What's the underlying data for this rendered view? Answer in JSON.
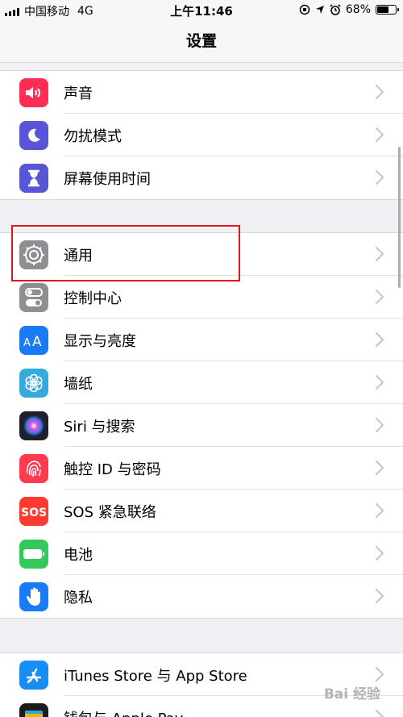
{
  "status_bar": {
    "carrier": "中国移动",
    "network": "4G",
    "time": "上午11:46",
    "battery_text": "68%",
    "battery_level": 0.68
  },
  "nav": {
    "title": "设置"
  },
  "groups": [
    {
      "items": [
        {
          "label": "声音",
          "icon": "speaker-icon",
          "color": "#fe2d55"
        },
        {
          "label": "勿扰模式",
          "icon": "moon-icon",
          "color": "#5856d6"
        },
        {
          "label": "屏幕使用时间",
          "icon": "hourglass-icon",
          "color": "#5856d6"
        }
      ]
    },
    {
      "items": [
        {
          "label": "通用",
          "icon": "gear-icon",
          "color": "#8e8e93"
        },
        {
          "label": "控制中心",
          "icon": "toggles-icon",
          "color": "#8e8e93"
        },
        {
          "label": "显示与亮度",
          "icon": "text-size-icon",
          "color": "#1a7cf5"
        },
        {
          "label": "墙纸",
          "icon": "flower-icon",
          "color": "#35aadc"
        },
        {
          "label": "Siri 与搜索",
          "icon": "siri-icon",
          "color": "#1f1f2e"
        },
        {
          "label": "触控 ID 与密码",
          "icon": "fingerprint-icon",
          "color": "#fe3b4f"
        },
        {
          "label": "SOS 紧急联络",
          "icon": "sos-icon",
          "color": "#fe3b30"
        },
        {
          "label": "电池",
          "icon": "battery-icon",
          "color": "#34c759"
        },
        {
          "label": "隐私",
          "icon": "hand-icon",
          "color": "#1a7cf5"
        }
      ]
    },
    {
      "items": [
        {
          "label": "iTunes Store 与 App Store",
          "icon": "app-store-icon",
          "color": "#1a8cf5"
        },
        {
          "label": "钱包与 Apple Pay",
          "icon": "wallet-icon",
          "color": "#1c1c1e"
        }
      ]
    }
  ],
  "watermark": "Bai 经验"
}
